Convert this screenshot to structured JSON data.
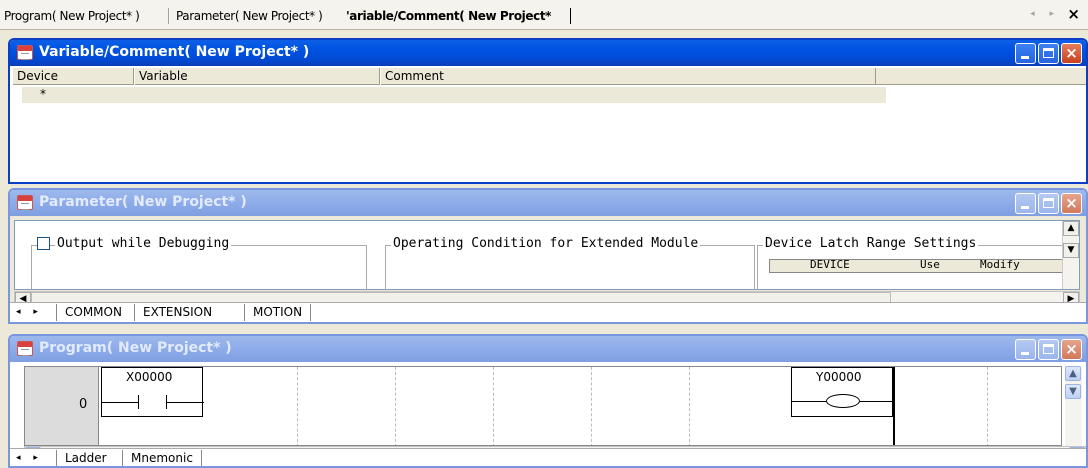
{
  "doc_tabs": {
    "items": [
      {
        "label": "Program( New Project* )"
      },
      {
        "label": "Parameter( New Project* )"
      },
      {
        "label": "'ariable/Comment( New Project*"
      }
    ],
    "close_glyph": "×"
  },
  "variable_window": {
    "title": "Variable/Comment( New Project* )",
    "columns": [
      "Device",
      "Variable",
      "Comment"
    ],
    "new_row_marker": "*"
  },
  "parameter_window": {
    "title": "Parameter( New Project* )",
    "checkbox_label": "Output while Debugging",
    "group_extended": "Operating Condition for Extended Module",
    "group_latch": "Device Latch Range Settings",
    "latch_columns": [
      "DEVICE",
      "Use",
      "Modify"
    ],
    "sheets": [
      "COMMON",
      "EXTENSION",
      "MOTION"
    ]
  },
  "program_window": {
    "title": "Program( New Project* )",
    "step": "0",
    "contact": "X00000",
    "coil": "Y00000",
    "sheets": [
      "Ladder",
      "Mnemonic"
    ]
  },
  "colors": {
    "active_title": "#0054e3",
    "inactive_title": "#8fadea",
    "close_button": "#c9411f",
    "face": "#ece9d8"
  }
}
